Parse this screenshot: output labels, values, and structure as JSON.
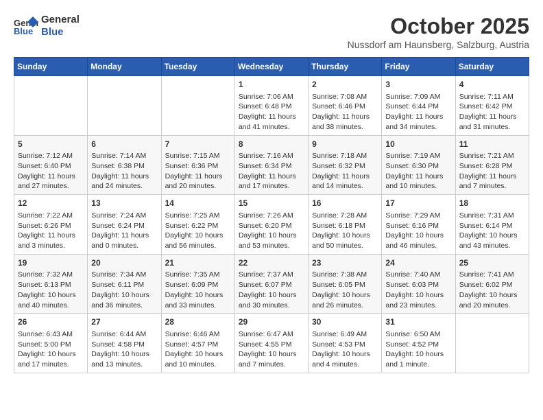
{
  "logo": {
    "line1": "General",
    "line2": "Blue"
  },
  "title": "October 2025",
  "subtitle": "Nussdorf am Haunsberg, Salzburg, Austria",
  "days_of_week": [
    "Sunday",
    "Monday",
    "Tuesday",
    "Wednesday",
    "Thursday",
    "Friday",
    "Saturday"
  ],
  "weeks": [
    [
      {
        "day": "",
        "info": ""
      },
      {
        "day": "",
        "info": ""
      },
      {
        "day": "",
        "info": ""
      },
      {
        "day": "1",
        "info": "Sunrise: 7:06 AM\nSunset: 6:48 PM\nDaylight: 11 hours and 41 minutes."
      },
      {
        "day": "2",
        "info": "Sunrise: 7:08 AM\nSunset: 6:46 PM\nDaylight: 11 hours and 38 minutes."
      },
      {
        "day": "3",
        "info": "Sunrise: 7:09 AM\nSunset: 6:44 PM\nDaylight: 11 hours and 34 minutes."
      },
      {
        "day": "4",
        "info": "Sunrise: 7:11 AM\nSunset: 6:42 PM\nDaylight: 11 hours and 31 minutes."
      }
    ],
    [
      {
        "day": "5",
        "info": "Sunrise: 7:12 AM\nSunset: 6:40 PM\nDaylight: 11 hours and 27 minutes."
      },
      {
        "day": "6",
        "info": "Sunrise: 7:14 AM\nSunset: 6:38 PM\nDaylight: 11 hours and 24 minutes."
      },
      {
        "day": "7",
        "info": "Sunrise: 7:15 AM\nSunset: 6:36 PM\nDaylight: 11 hours and 20 minutes."
      },
      {
        "day": "8",
        "info": "Sunrise: 7:16 AM\nSunset: 6:34 PM\nDaylight: 11 hours and 17 minutes."
      },
      {
        "day": "9",
        "info": "Sunrise: 7:18 AM\nSunset: 6:32 PM\nDaylight: 11 hours and 14 minutes."
      },
      {
        "day": "10",
        "info": "Sunrise: 7:19 AM\nSunset: 6:30 PM\nDaylight: 11 hours and 10 minutes."
      },
      {
        "day": "11",
        "info": "Sunrise: 7:21 AM\nSunset: 6:28 PM\nDaylight: 11 hours and 7 minutes."
      }
    ],
    [
      {
        "day": "12",
        "info": "Sunrise: 7:22 AM\nSunset: 6:26 PM\nDaylight: 11 hours and 3 minutes."
      },
      {
        "day": "13",
        "info": "Sunrise: 7:24 AM\nSunset: 6:24 PM\nDaylight: 11 hours and 0 minutes."
      },
      {
        "day": "14",
        "info": "Sunrise: 7:25 AM\nSunset: 6:22 PM\nDaylight: 10 hours and 56 minutes."
      },
      {
        "day": "15",
        "info": "Sunrise: 7:26 AM\nSunset: 6:20 PM\nDaylight: 10 hours and 53 minutes."
      },
      {
        "day": "16",
        "info": "Sunrise: 7:28 AM\nSunset: 6:18 PM\nDaylight: 10 hours and 50 minutes."
      },
      {
        "day": "17",
        "info": "Sunrise: 7:29 AM\nSunset: 6:16 PM\nDaylight: 10 hours and 46 minutes."
      },
      {
        "day": "18",
        "info": "Sunrise: 7:31 AM\nSunset: 6:14 PM\nDaylight: 10 hours and 43 minutes."
      }
    ],
    [
      {
        "day": "19",
        "info": "Sunrise: 7:32 AM\nSunset: 6:13 PM\nDaylight: 10 hours and 40 minutes."
      },
      {
        "day": "20",
        "info": "Sunrise: 7:34 AM\nSunset: 6:11 PM\nDaylight: 10 hours and 36 minutes."
      },
      {
        "day": "21",
        "info": "Sunrise: 7:35 AM\nSunset: 6:09 PM\nDaylight: 10 hours and 33 minutes."
      },
      {
        "day": "22",
        "info": "Sunrise: 7:37 AM\nSunset: 6:07 PM\nDaylight: 10 hours and 30 minutes."
      },
      {
        "day": "23",
        "info": "Sunrise: 7:38 AM\nSunset: 6:05 PM\nDaylight: 10 hours and 26 minutes."
      },
      {
        "day": "24",
        "info": "Sunrise: 7:40 AM\nSunset: 6:03 PM\nDaylight: 10 hours and 23 minutes."
      },
      {
        "day": "25",
        "info": "Sunrise: 7:41 AM\nSunset: 6:02 PM\nDaylight: 10 hours and 20 minutes."
      }
    ],
    [
      {
        "day": "26",
        "info": "Sunrise: 6:43 AM\nSunset: 5:00 PM\nDaylight: 10 hours and 17 minutes."
      },
      {
        "day": "27",
        "info": "Sunrise: 6:44 AM\nSunset: 4:58 PM\nDaylight: 10 hours and 13 minutes."
      },
      {
        "day": "28",
        "info": "Sunrise: 6:46 AM\nSunset: 4:57 PM\nDaylight: 10 hours and 10 minutes."
      },
      {
        "day": "29",
        "info": "Sunrise: 6:47 AM\nSunset: 4:55 PM\nDaylight: 10 hours and 7 minutes."
      },
      {
        "day": "30",
        "info": "Sunrise: 6:49 AM\nSunset: 4:53 PM\nDaylight: 10 hours and 4 minutes."
      },
      {
        "day": "31",
        "info": "Sunrise: 6:50 AM\nSunset: 4:52 PM\nDaylight: 10 hours and 1 minute."
      },
      {
        "day": "",
        "info": ""
      }
    ]
  ]
}
